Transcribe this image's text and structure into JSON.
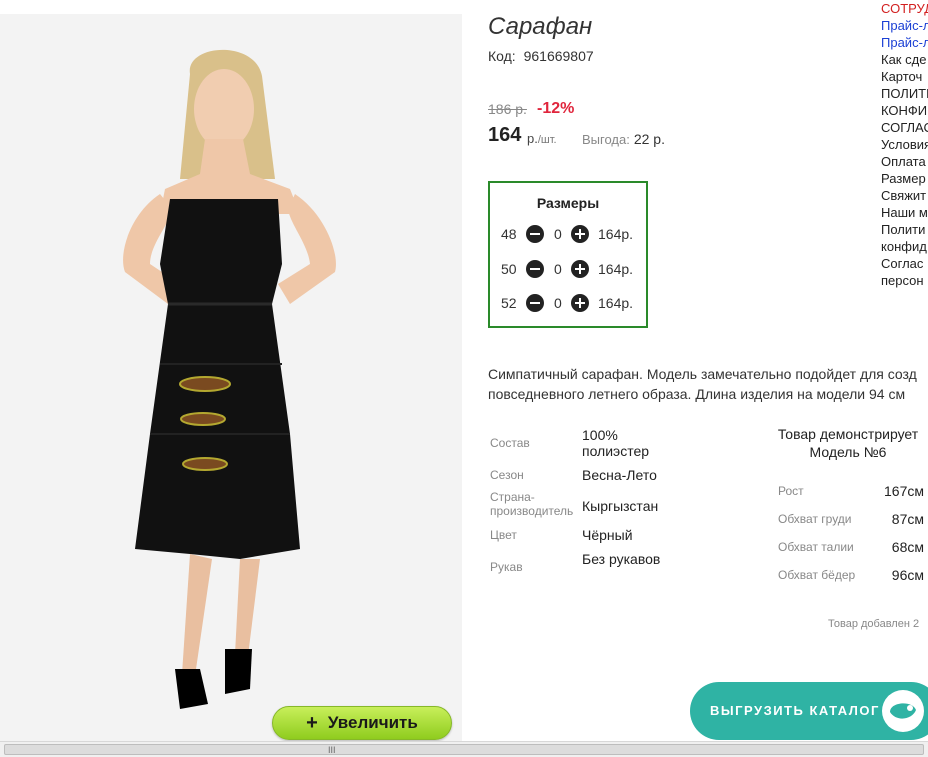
{
  "product": {
    "title": "Сарафан",
    "code_label": "Код:",
    "code": "961669807",
    "old_price": "186 р.",
    "discount": "-12%",
    "price": "164",
    "price_unit": "р.",
    "price_per": "/шт.",
    "benefit_label": "Выгода:",
    "benefit_value": "22 р."
  },
  "sizes": {
    "heading": "Размеры",
    "rows": [
      {
        "size": "48",
        "qty": "0",
        "price": "164р."
      },
      {
        "size": "50",
        "qty": "0",
        "price": "164р."
      },
      {
        "size": "52",
        "qty": "0",
        "price": "164р."
      }
    ]
  },
  "description": {
    "line1": "Симпатичный сарафан. Модель замечательно подойдет для созд",
    "line2": "повседневного летнего образа. Длина изделия на модели 94 см"
  },
  "specs": [
    {
      "key": "Состав",
      "value": "100% полиэстер"
    },
    {
      "key": "Сезон",
      "value": "Весна-Лето"
    },
    {
      "key": "Страна-производитель",
      "value": "Кыргызстан"
    },
    {
      "key": "Цвет",
      "value": "Чёрный"
    },
    {
      "key": "Рукав",
      "value": "Без рукавов"
    }
  ],
  "model": {
    "title_line1": "Товар демонстрирует",
    "title_line2": "Модель №6",
    "rows": [
      {
        "key": "Рост",
        "value": "167см"
      },
      {
        "key": "Обхват груди",
        "value": "87см"
      },
      {
        "key": "Обхват талии",
        "value": "68см"
      },
      {
        "key": "Обхват бёдер",
        "value": "96см"
      }
    ],
    "added": "Товар добавлен 2"
  },
  "links": [
    {
      "text": "СОТРУД",
      "color": "#d22020"
    },
    {
      "text": "Прайс-л",
      "color": "#1a3fd4"
    },
    {
      "text": "Прайс-л",
      "color": "#1a3fd4"
    },
    {
      "text": "Как сде",
      "color": "#222222"
    },
    {
      "text": "Карточ",
      "color": "#222222"
    },
    {
      "text": "ПОЛИТИ",
      "color": "#222222"
    },
    {
      "text": "КОНФИ",
      "color": "#222222"
    },
    {
      "text": "СОГЛАС",
      "color": "#222222"
    },
    {
      "text": "Условия",
      "color": "#222222"
    },
    {
      "text": "Оплата",
      "color": "#222222"
    },
    {
      "text": "Размер",
      "color": "#222222"
    },
    {
      "text": "Свяжит",
      "color": "#222222"
    },
    {
      "text": "Наши м",
      "color": "#222222"
    },
    {
      "text": "Полити",
      "color": "#222222"
    },
    {
      "text": "конфид",
      "color": "#222222"
    },
    {
      "text": "Соглас",
      "color": "#222222"
    },
    {
      "text": "персон",
      "color": "#222222"
    }
  ],
  "buttons": {
    "zoom_plus": "+",
    "zoom_label": "Увеличить",
    "export_label": "ВЫГРУЗИТЬ КАТАЛОГ"
  },
  "scrollbar": {
    "grip": "III"
  },
  "colors": {
    "accent_green": "#2a8a2a",
    "discount_red": "#e0253c",
    "export_teal": "#2fb3a4",
    "zoom_green": "#9fd628"
  }
}
